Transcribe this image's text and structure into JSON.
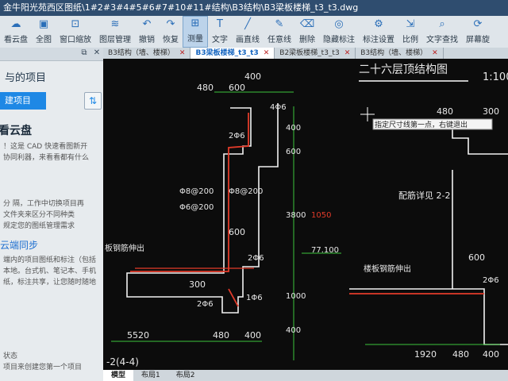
{
  "window": {
    "title": "金牛阳光苑西区图纸\\1#2#3#4#5#6#7#10#11#结构\\B3结构\\B3梁板楼梯_t3_t3.dwg"
  },
  "toolbar": {
    "items": [
      {
        "label": "看云盘",
        "icon": "cloud-icon"
      },
      {
        "label": "全图",
        "icon": "fit-icon"
      },
      {
        "label": "窗口缩放",
        "icon": "zoom-window-icon"
      },
      {
        "label": "图层管理",
        "icon": "layers-icon"
      },
      {
        "label": "撤销",
        "icon": "undo-icon"
      },
      {
        "label": "恢复",
        "icon": "redo-icon"
      },
      {
        "label": "测量",
        "icon": "measure-icon"
      },
      {
        "label": "文字",
        "icon": "text-icon"
      },
      {
        "label": "画直线",
        "icon": "line-icon"
      },
      {
        "label": "任意线",
        "icon": "pen-icon"
      },
      {
        "label": "删除",
        "icon": "eraser-icon"
      },
      {
        "label": "隐藏标注",
        "icon": "hide-icon"
      },
      {
        "label": "标注设置",
        "icon": "settings-icon"
      },
      {
        "label": "比例",
        "icon": "scale-icon"
      },
      {
        "label": "文字查找",
        "icon": "find-text-icon"
      },
      {
        "label": "屏幕旋",
        "icon": "rotate-icon"
      }
    ]
  },
  "sidebar": {
    "section_title": "与的项目",
    "new_button": "建项目",
    "cloud_title": "看云盘",
    "cloud_text": [
      "！这是 CAD 快速看图新开",
      "协同利器，来看看都有什么"
    ],
    "tip_text": [
      "分 隔，工作中切换项目再",
      "文件夹来区分不同种类",
      "规定您的图纸管理需求"
    ],
    "sync_link": "云端同步",
    "sync_text": [
      "端内的项目图纸和标注（包括",
      "本地。台式机、笔记本、手机",
      "纸，标注共享，让您随时随地"
    ],
    "status_lines": [
      "状态",
      "项目来创建您第一个项目"
    ]
  },
  "tabs": [
    {
      "label": "B3结构（墙、楼梯）",
      "active": false
    },
    {
      "label": "B3梁板楼梯_t3_t3",
      "active": true
    },
    {
      "label": "B2梁板楼梯_t3_t3",
      "active": false
    },
    {
      "label": "B3结构（墙、楼梯）",
      "active": false
    }
  ],
  "drawing": {
    "heading": "二十六层顶结构图",
    "scale": "1:100",
    "tooltip": "指定尺寸线第一点，右键退出",
    "section_label": "配筋详见 2-2",
    "note_left": "板钢筋伸出",
    "note_right": "楼板钢筋伸出",
    "dims": [
      "480",
      "600",
      "400",
      "400",
      "600",
      "3800",
      "1050",
      "600",
      "1000",
      "400",
      "300",
      "480",
      "400",
      "5520",
      "480",
      "1920",
      "480",
      "400",
      "300",
      "600",
      "77.100"
    ],
    "rebar_labels": [
      "4Φ6",
      "2Φ6",
      "Φ8@200",
      "Φ8@200",
      "Φ6@200",
      "2Φ6",
      "2Φ6",
      "1Φ6",
      "2Φ6"
    ],
    "bottom_note": "-2(4-4)"
  },
  "bottom_tabs": [
    {
      "label": "模型",
      "active": true
    },
    {
      "label": "布局1",
      "active": false
    },
    {
      "label": "布局2",
      "active": false
    }
  ]
}
